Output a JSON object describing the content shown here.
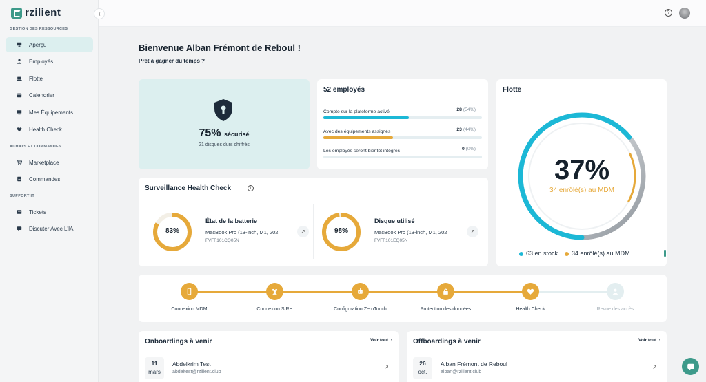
{
  "brand": {
    "name": "rzilient",
    "accent": "#3d9a8a"
  },
  "sidebar": {
    "sections": [
      {
        "label": "GESTION DES RESSOURCES"
      },
      {
        "label": "ACHATS ET COMMANDES"
      },
      {
        "label": "SUPPORT IT"
      }
    ],
    "items": [
      {
        "label": "Aperçu",
        "icon": "monitor-icon",
        "active": true
      },
      {
        "label": "Employés",
        "icon": "users-icon"
      },
      {
        "label": "Flotte",
        "icon": "laptop-icon"
      },
      {
        "label": "Calendrier",
        "icon": "calendar-icon"
      },
      {
        "label": "Mes Équipements",
        "icon": "devices-icon"
      },
      {
        "label": "Health Check",
        "icon": "heart-icon"
      },
      {
        "label": "Marketplace",
        "icon": "cart-icon"
      },
      {
        "label": "Commandes",
        "icon": "list-icon"
      },
      {
        "label": "Tickets",
        "icon": "ticket-icon"
      },
      {
        "label": "Discuter Avec L'IA",
        "icon": "chat-icon"
      }
    ],
    "collapse_icon": "‹"
  },
  "topbar": {
    "help_icon": "?",
    "avatar": "avatar"
  },
  "welcome": {
    "title": "Bienvenue Alban Frémont de Reboul !",
    "subtitle": "Prêt à gagner du temps ?"
  },
  "security": {
    "percent": "75%",
    "label": "sécurisé",
    "sub": "21 disques durs chiffrés"
  },
  "employees": {
    "title": "52 employés",
    "rows": [
      {
        "label": "Compte sur la plateforme activé",
        "value": "28",
        "pct": "(54%)",
        "fill": 0.54,
        "color": "#1cb8d6"
      },
      {
        "label": "Avec des équipements assignés",
        "value": "23",
        "pct": "(44%)",
        "fill": 0.44,
        "color": "#e6a93a"
      },
      {
        "label": "Les employés seront bientôt intégrés",
        "value": "0",
        "pct": "(0%)",
        "fill": 0.0,
        "color": "#1cb8d6"
      }
    ]
  },
  "fleet": {
    "title": "Flotte",
    "percent": "37%",
    "sub": "34 enrôlé(s) au MDM",
    "stock_fraction": 0.64,
    "mdm_fraction": 0.37,
    "legend": [
      {
        "label": "63 en stock",
        "color": "#1cb8d6"
      },
      {
        "label": "34 enrôlé(s) au MDM",
        "color": "#e6a93a"
      }
    ]
  },
  "health": {
    "title": "Surveillance Health Check",
    "items": [
      {
        "value": "83%",
        "fraction": 0.83,
        "name": "État de la batterie",
        "model": "MacBook Pro (13-inch, M1, 202",
        "serial": "FVFF101CQ05N"
      },
      {
        "value": "98%",
        "fraction": 0.98,
        "name": "Disque utilisé",
        "model": "MacBook Pro (13-inch, M1, 202",
        "serial": "FVFF101EQ05N"
      }
    ]
  },
  "steps": [
    {
      "label": "Connexion MDM",
      "done": true,
      "icon": "phone-icon"
    },
    {
      "label": "Connexion SIRH",
      "done": true,
      "icon": "people-icon"
    },
    {
      "label": "Configuration ZeroTouch",
      "done": true,
      "icon": "robot-icon"
    },
    {
      "label": "Protection des données",
      "done": true,
      "icon": "lock-icon"
    },
    {
      "label": "Health Check",
      "done": true,
      "icon": "heart-icon"
    },
    {
      "label": "Revue des accès",
      "done": false,
      "icon": "user-check-icon"
    }
  ],
  "onboardings": {
    "title": "Onboardings à venir",
    "link": "Voir tout",
    "day": "11",
    "month": "mars",
    "name": "Abdelkrim Test",
    "email": "abdeltest@rzilient.club"
  },
  "offboardings": {
    "title": "Offboardings à venir",
    "link": "Voir tout",
    "day": "26",
    "month": "oct.",
    "name": "Alban Frémont de Reboul",
    "email": "alban@rzilient.club"
  }
}
